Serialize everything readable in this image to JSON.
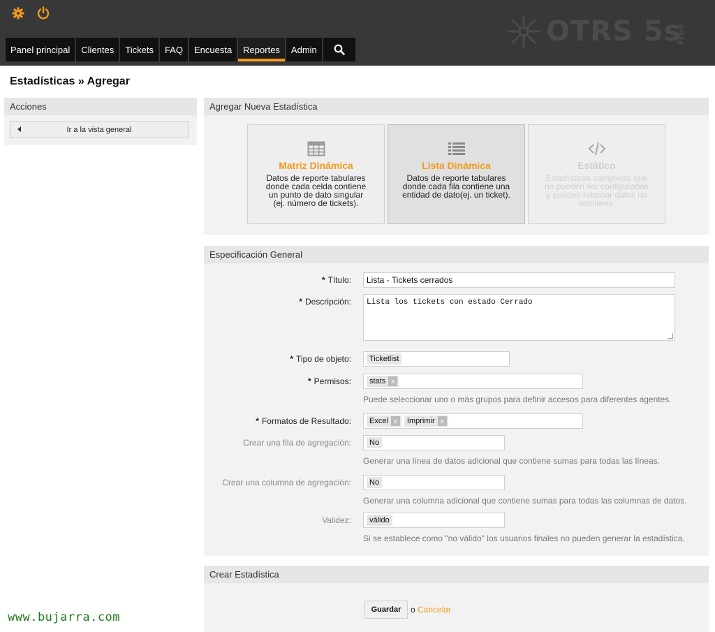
{
  "header": {
    "icons": [
      "gear-icon",
      "power-icon"
    ],
    "logo_text": "OTRS 5s",
    "logo_badge": "Free",
    "nav": [
      {
        "label": "Panel principal"
      },
      {
        "label": "Clientes"
      },
      {
        "label": "Tickets"
      },
      {
        "label": "FAQ"
      },
      {
        "label": "Encuesta"
      },
      {
        "label": "Reportes",
        "active": true
      },
      {
        "label": "Admin"
      }
    ],
    "search_icon": "search-icon"
  },
  "page": {
    "title": "Estadísticas » Agregar"
  },
  "sidebar": {
    "title": "Acciones",
    "overview_button": "Ir a la vista general"
  },
  "add_widget": {
    "title": "Agregar Nueva Estadística",
    "types": [
      {
        "title": "Matriz Dinámica",
        "description": "Datos de reporte tabulares donde cada celda contiene un punto de dato singular (ej. número de tickets).",
        "icon": "table-icon",
        "state": "normal"
      },
      {
        "title": "Lista Dinámica",
        "description": "Datos de reporte tabulares donde cada fila contiene una entidad de dato(ej. un ticket).",
        "icon": "list-icon",
        "state": "selected"
      },
      {
        "title": "Estático",
        "description": "Estadísticas complejas que no pueden ser configuradas y pueden retornar datos no tabulares.",
        "icon": "code-icon",
        "state": "disabled"
      }
    ]
  },
  "spec": {
    "title": "Especificación General",
    "required_mark": "*",
    "titulo": {
      "label": "Título:",
      "value": "Lista - Tickets cerrados"
    },
    "descripcion": {
      "label": "Descripción:",
      "value": "Lista los tickets con estado Cerrado"
    },
    "tipo": {
      "label": "Tipo de objeto:",
      "value": "Ticketlist"
    },
    "permisos": {
      "label": "Permisos:",
      "tags": [
        "stats"
      ],
      "help": "Puede seleccionar uno o más grupos para definir accesos para diferentes agentes."
    },
    "formatos": {
      "label": "Formatos de Resultado:",
      "tags": [
        "Excel",
        "Imprimir"
      ]
    },
    "fila": {
      "label": "Crear una fila de agregación:",
      "value": "No",
      "help": "Generar una línea de datos adicional que contiene sumas para todas las líneas."
    },
    "columna": {
      "label": "Crear una columna de agregación:",
      "value": "No",
      "help": "Generar una columna adicional que contiene sumas para todas las columnas de datos."
    },
    "validez": {
      "label": "Validez:",
      "value": "válido",
      "help": "Si se establece como \"no válido\" los usuarios finales no pueden generar la estadística."
    },
    "tag_remove": "x"
  },
  "create": {
    "title": "Crear Estadística",
    "save": "Guardar",
    "or": "o",
    "cancel": "Cancelar"
  },
  "watermark": "www.bujarra.com",
  "colors": {
    "accent": "#f49b1b",
    "header": "#383838",
    "nav": "#111111"
  }
}
